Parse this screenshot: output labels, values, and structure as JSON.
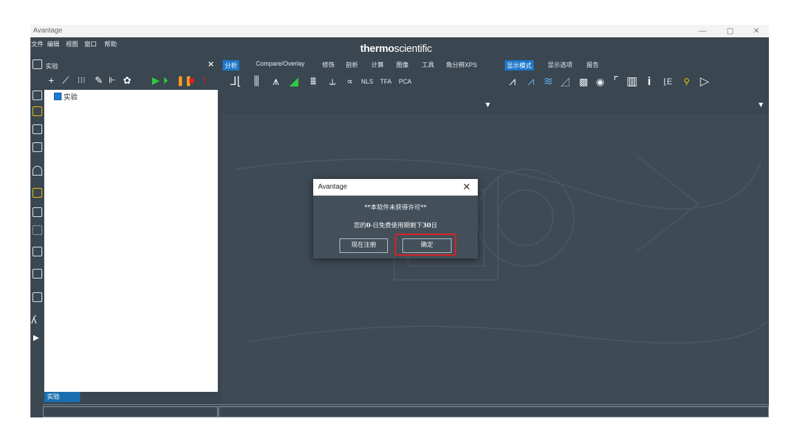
{
  "window": {
    "title": "Avantage",
    "minimize": "—",
    "restore": "▢",
    "close": "✕"
  },
  "menu": [
    "文件",
    "编辑",
    "视图",
    "窗口",
    "帮助"
  ],
  "brand": {
    "bold": "thermo",
    "light": "scientific"
  },
  "experiment_panel": {
    "title": "实验",
    "close": "✕",
    "tree_root": "实验",
    "bottom_tab": "实验"
  },
  "toolbar_tabs": [
    {
      "label": "分析",
      "active": true
    },
    {
      "label": "Compare/Overlay",
      "active": false
    },
    {
      "label": "修饰",
      "active": false
    },
    {
      "label": "剖析",
      "active": false
    },
    {
      "label": "计算",
      "active": false
    },
    {
      "label": "图像",
      "active": false
    },
    {
      "label": "工具",
      "active": false
    },
    {
      "label": "角分辨XPS",
      "active": false
    },
    {
      "label": "显示模式",
      "active": true
    },
    {
      "label": "显示选项",
      "active": false
    },
    {
      "label": "报告",
      "active": false
    }
  ],
  "dialog": {
    "title": "Avantage",
    "close": "✕",
    "message_line1": "**本软件未获得许可**",
    "message_line2_prefix": "您的",
    "message_line2_bold1": "0",
    "message_line2_middle": "-日免费使用期剩下",
    "message_line2_bold2": "30",
    "message_line2_suffix": "日",
    "register_button": "现在注册",
    "ok_button": "确定"
  },
  "colors": {
    "app_bg": "#3a4650",
    "active_tab": "#1e77c9",
    "highlight": "#dd2222",
    "play_green": "#2ecc40",
    "pause_orange": "#ff9f1a",
    "stop_red": "#e02020"
  }
}
